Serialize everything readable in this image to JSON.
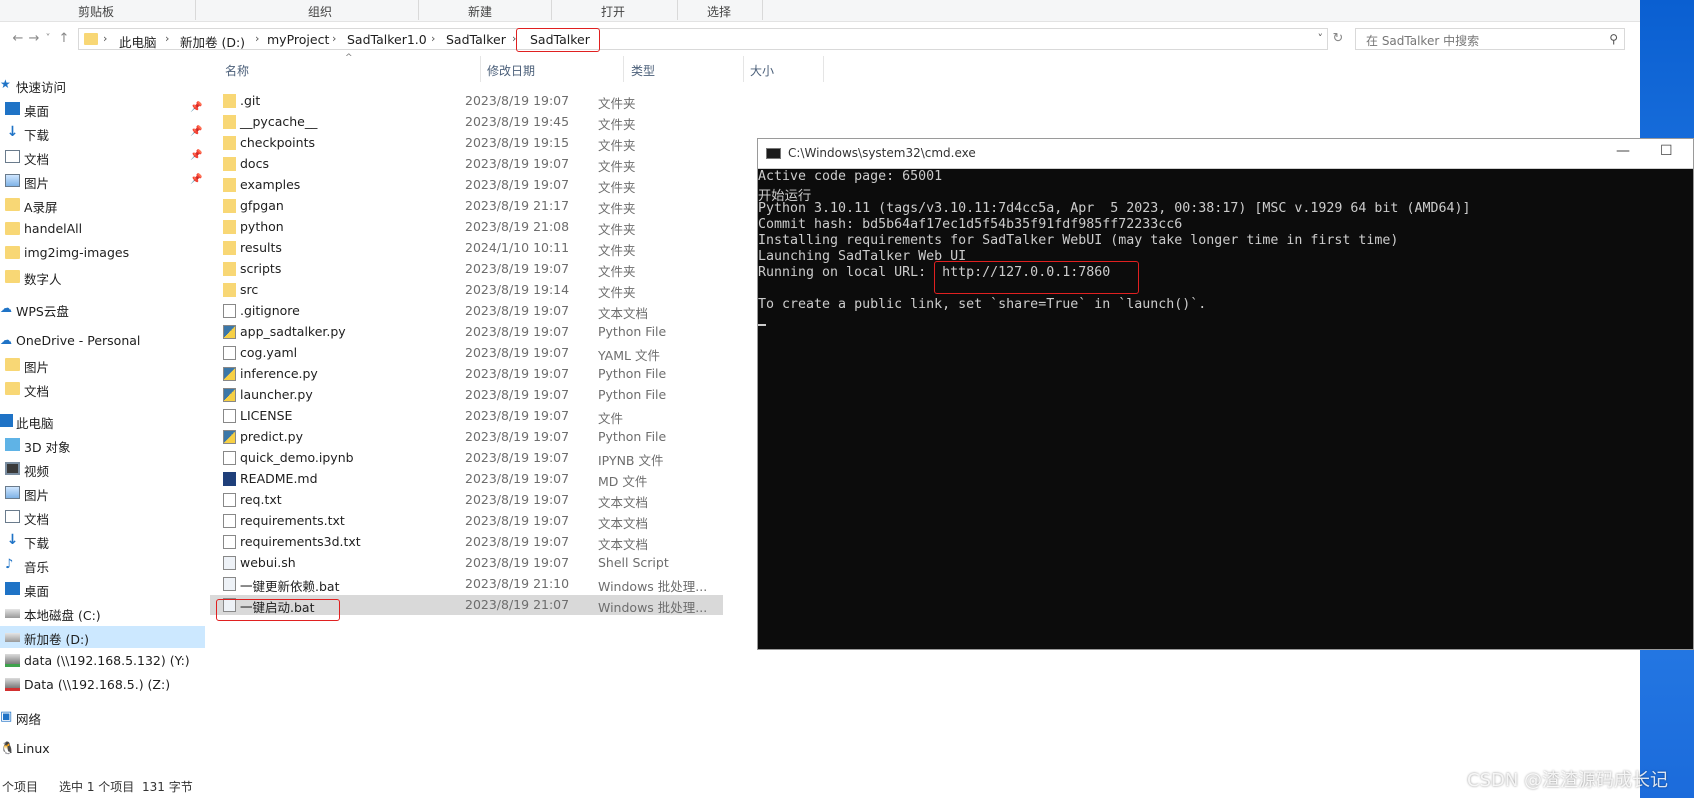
{
  "ribbon": {
    "groups": [
      "剪贴板",
      "组织",
      "新建",
      "打开",
      "选择"
    ]
  },
  "address": {
    "crumbs": [
      "此电脑",
      "新加卷 (D:)",
      "myProject",
      "SadTalker1.0",
      "SadTalker",
      "SadTalker"
    ],
    "search_placeholder": "在 SadTalker 中搜索"
  },
  "nav": {
    "items": [
      {
        "label": "快速访问",
        "icon": "star-icon"
      },
      {
        "label": "桌面",
        "icon": "desktop-icon",
        "pinned": true
      },
      {
        "label": "下载",
        "icon": "download-icon",
        "pinned": true
      },
      {
        "label": "文档",
        "icon": "document-icon",
        "pinned": true
      },
      {
        "label": "图片",
        "icon": "picture-icon",
        "pinned": true
      },
      {
        "label": "A录屏",
        "icon": "folder-icon"
      },
      {
        "label": "handelAll",
        "icon": "folder-icon"
      },
      {
        "label": "img2img-images",
        "icon": "folder-icon"
      },
      {
        "label": "数字人",
        "icon": "folder-icon"
      },
      {
        "label": "WPS云盘",
        "icon": "cloud-icon"
      },
      {
        "label": "OneDrive - Personal",
        "icon": "cloud-icon"
      },
      {
        "label": "图片",
        "icon": "folder-icon"
      },
      {
        "label": "文档",
        "icon": "folder-icon"
      },
      {
        "label": "此电脑",
        "icon": "computer-icon"
      },
      {
        "label": "3D 对象",
        "icon": "3d-object-icon"
      },
      {
        "label": "视频",
        "icon": "video-icon"
      },
      {
        "label": "图片",
        "icon": "picture-icon"
      },
      {
        "label": "文档",
        "icon": "document-icon"
      },
      {
        "label": "下载",
        "icon": "download-icon"
      },
      {
        "label": "音乐",
        "icon": "music-icon"
      },
      {
        "label": "桌面",
        "icon": "desktop-icon"
      },
      {
        "label": "本地磁盘 (C:)",
        "icon": "drive-icon"
      },
      {
        "label": "新加卷 (D:)",
        "icon": "drive-icon",
        "selected": true
      },
      {
        "label": "data (\\\\192.168.5.132) (Y:)",
        "icon": "network-drive-icon"
      },
      {
        "label": "Data (\\\\192.168.5.) (Z:)",
        "icon": "network-drive-disconnected-icon"
      },
      {
        "label": "网络",
        "icon": "network-icon"
      },
      {
        "label": "Linux",
        "icon": "linux-icon"
      }
    ]
  },
  "columns": {
    "name": "名称",
    "date": "修改日期",
    "type": "类型",
    "size": "大小"
  },
  "files": [
    {
      "name": ".git",
      "date": "2023/8/19 19:07",
      "type": "文件夹",
      "icon": "folder-icon"
    },
    {
      "name": "__pycache__",
      "date": "2023/8/19 19:45",
      "type": "文件夹",
      "icon": "folder-icon"
    },
    {
      "name": "checkpoints",
      "date": "2023/8/19 19:15",
      "type": "文件夹",
      "icon": "folder-icon"
    },
    {
      "name": "docs",
      "date": "2023/8/19 19:07",
      "type": "文件夹",
      "icon": "folder-icon"
    },
    {
      "name": "examples",
      "date": "2023/8/19 19:07",
      "type": "文件夹",
      "icon": "folder-icon"
    },
    {
      "name": "gfpgan",
      "date": "2023/8/19 21:17",
      "type": "文件夹",
      "icon": "folder-icon"
    },
    {
      "name": "python",
      "date": "2023/8/19 21:08",
      "type": "文件夹",
      "icon": "folder-icon"
    },
    {
      "name": "results",
      "date": "2024/1/10 10:11",
      "type": "文件夹",
      "icon": "folder-icon"
    },
    {
      "name": "scripts",
      "date": "2023/8/19 19:07",
      "type": "文件夹",
      "icon": "folder-icon"
    },
    {
      "name": "src",
      "date": "2023/8/19 19:14",
      "type": "文件夹",
      "icon": "folder-icon"
    },
    {
      "name": ".gitignore",
      "date": "2023/8/19 19:07",
      "type": "文本文档",
      "icon": "text-file-icon"
    },
    {
      "name": "app_sadtalker.py",
      "date": "2023/8/19 19:07",
      "type": "Python File",
      "icon": "python-file-icon"
    },
    {
      "name": "cog.yaml",
      "date": "2023/8/19 19:07",
      "type": "YAML 文件",
      "icon": "file-icon"
    },
    {
      "name": "inference.py",
      "date": "2023/8/19 19:07",
      "type": "Python File",
      "icon": "python-file-icon"
    },
    {
      "name": "launcher.py",
      "date": "2023/8/19 19:07",
      "type": "Python File",
      "icon": "python-file-icon"
    },
    {
      "name": "LICENSE",
      "date": "2023/8/19 19:07",
      "type": "文件",
      "icon": "file-icon"
    },
    {
      "name": "predict.py",
      "date": "2023/8/19 19:07",
      "type": "Python File",
      "icon": "python-file-icon"
    },
    {
      "name": "quick_demo.ipynb",
      "date": "2023/8/19 19:07",
      "type": "IPYNB 文件",
      "icon": "file-icon"
    },
    {
      "name": "README.md",
      "date": "2023/8/19 19:07",
      "type": "MD 文件",
      "icon": "markdown-file-icon"
    },
    {
      "name": "req.txt",
      "date": "2023/8/19 19:07",
      "type": "文本文档",
      "icon": "text-file-icon"
    },
    {
      "name": "requirements.txt",
      "date": "2023/8/19 19:07",
      "type": "文本文档",
      "icon": "text-file-icon"
    },
    {
      "name": "requirements3d.txt",
      "date": "2023/8/19 19:07",
      "type": "文本文档",
      "icon": "text-file-icon"
    },
    {
      "name": "webui.sh",
      "date": "2023/8/19 19:07",
      "type": "Shell Script",
      "icon": "script-file-icon"
    },
    {
      "name": "一键更新依赖.bat",
      "date": "2023/8/19 21:10",
      "type": "Windows 批处理...",
      "icon": "batch-file-icon"
    },
    {
      "name": "一键启动.bat",
      "date": "2023/8/19 21:07",
      "type": "Windows 批处理...",
      "icon": "batch-file-icon",
      "selected": true
    }
  ],
  "status": {
    "count": "个项目",
    "selected": "选中 1 个项目",
    "size": "131 字节"
  },
  "cmd": {
    "title": "C:\\Windows\\system32\\cmd.exe",
    "lines": [
      "Active code page: 65001",
      "开始运行",
      "Python 3.10.11 (tags/v3.10.11:7d4cc5a, Apr  5 2023, 00:38:17) [MSC v.1929 64 bit (AMD64)]",
      "Commit hash: bd5b64af17ec1d5f54b35f91fdf985ff72233cc6",
      "Installing requirements for SadTalker WebUI (may take longer time in first time)",
      "Launching SadTalker Web UI",
      "Running on local URL:  http://127.0.0.1:7860",
      "",
      "To create a public link, set `share=True` in `launch()`."
    ]
  },
  "watermark": "CSDN @渣渣源码成长记",
  "colors": {
    "highlight_red": "#e02020",
    "selection": "#cce8ff",
    "console_bg": "#0c0c0c"
  }
}
